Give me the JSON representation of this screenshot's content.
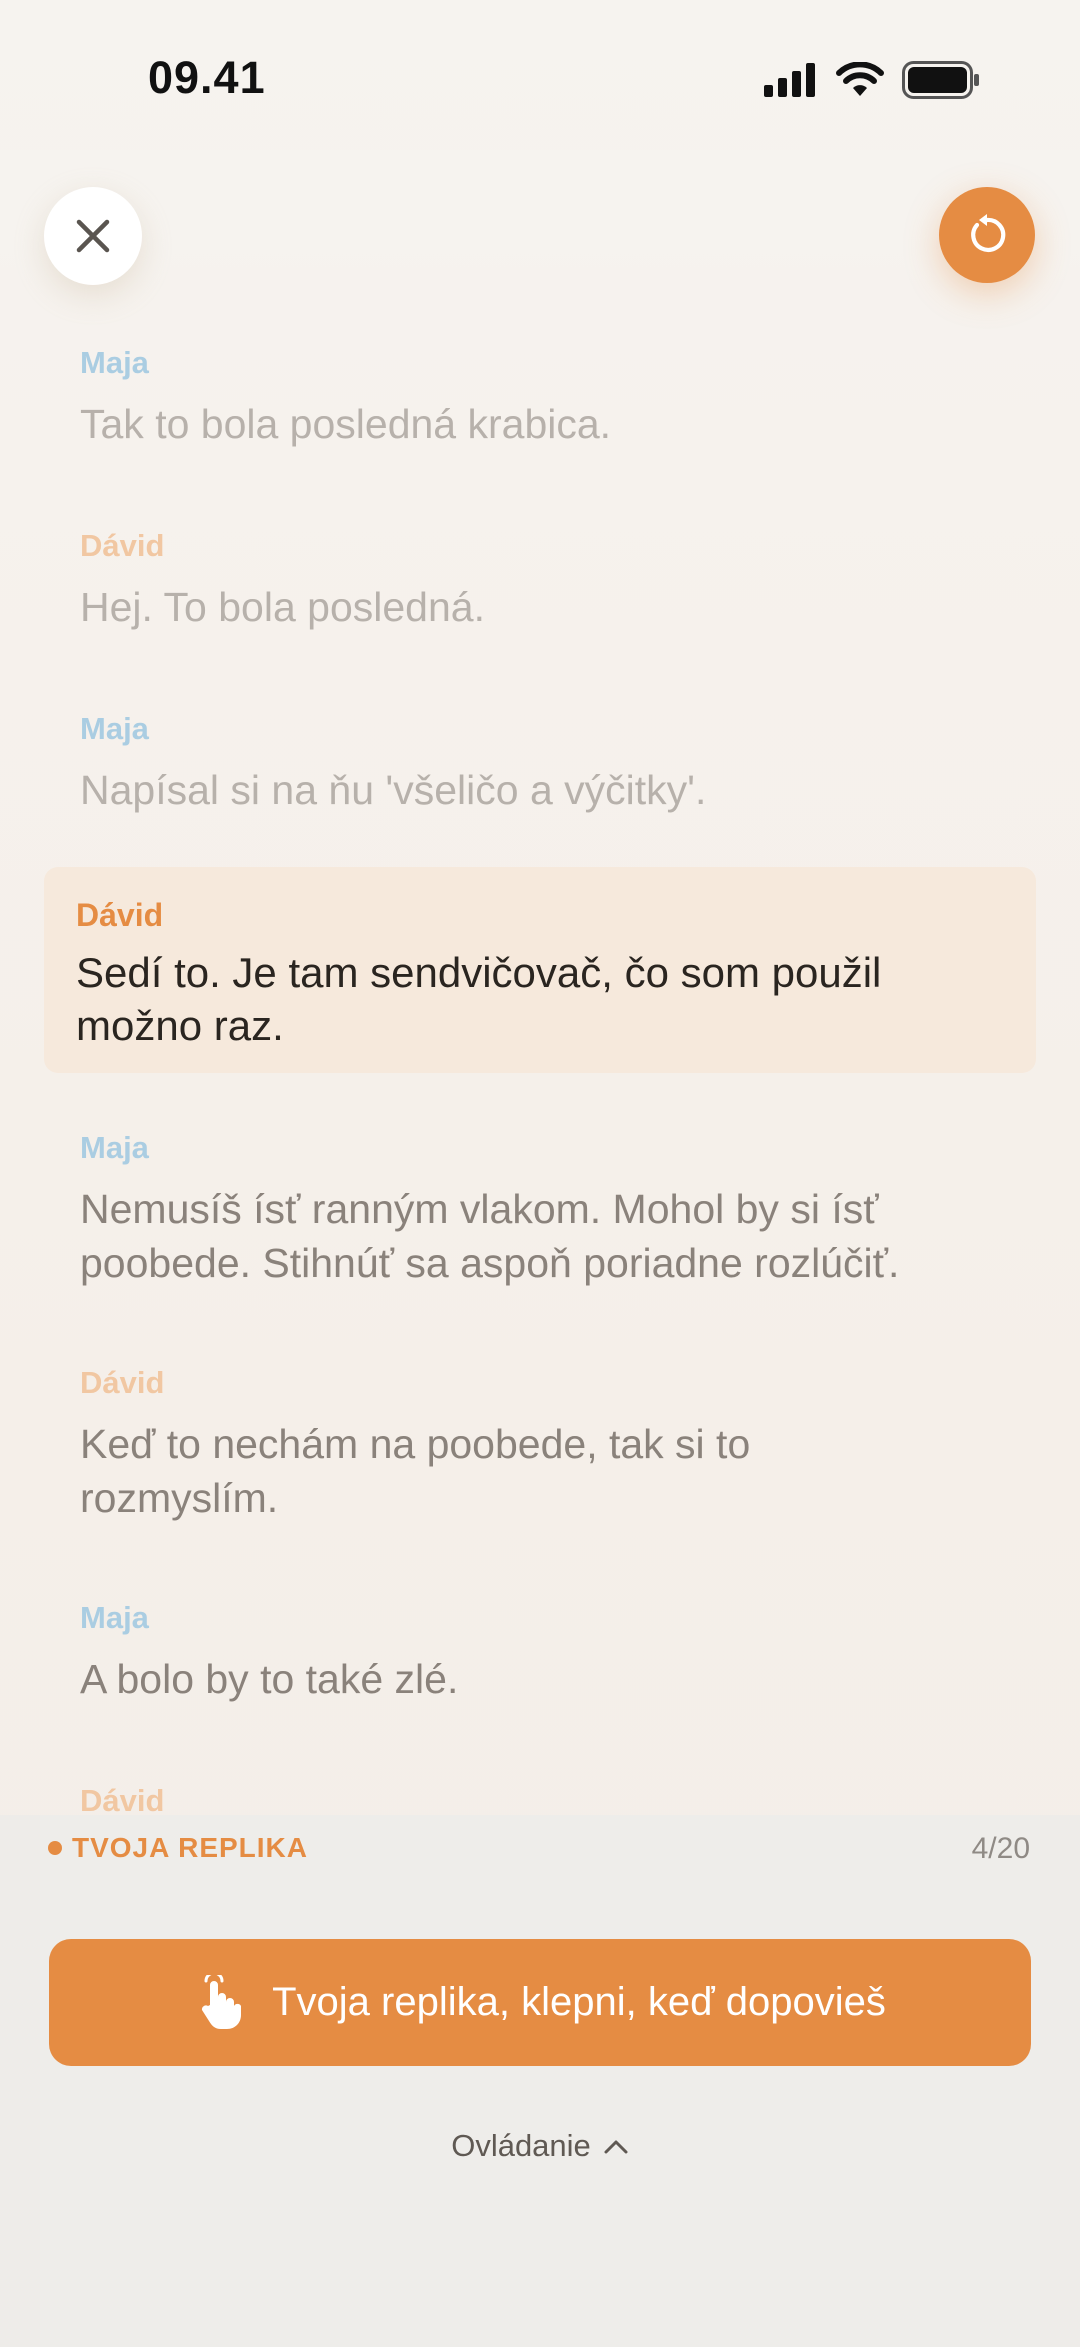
{
  "status": {
    "time": "09.41"
  },
  "toolbar": {
    "close_icon": "close-icon",
    "reset_icon": "restart-icon"
  },
  "script": {
    "lines": [
      {
        "speaker": "Maja",
        "text": "Tak to bola posledná krabica."
      },
      {
        "speaker": "Dávid",
        "text": "Hej. To bola posledná."
      },
      {
        "speaker": "Maja",
        "text": "Napísal si na ňu 'všeličo a výčitky'."
      },
      {
        "speaker": "Dávid",
        "text": "Sedí to. Je tam sendvičovač, čo som použil možno raz."
      },
      {
        "speaker": "Maja",
        "text": "Nemusíš ísť ranným vlakom. Mohol by si ísť poobede. Stihnúť sa aspoň poriadne rozlúčiť."
      },
      {
        "speaker": "Dávid",
        "text": "Keď to nechám na poobede, tak si to rozmyslím."
      },
      {
        "speaker": "Maja",
        "text": "A bolo by to také zlé."
      },
      {
        "speaker": "Dávid",
        "text": ""
      }
    ]
  },
  "panel": {
    "role_label": "TVOJA REPLIKA",
    "counter": "4/20",
    "cue_button": "Tvoja replika, klepni, keď dopovieš",
    "controls_label": "Ovládanie"
  },
  "colors": {
    "accent": "#e58c43",
    "maja": "#aacde2",
    "david": "#f1c7a2",
    "highlight_bg": "#f6e9dc"
  }
}
